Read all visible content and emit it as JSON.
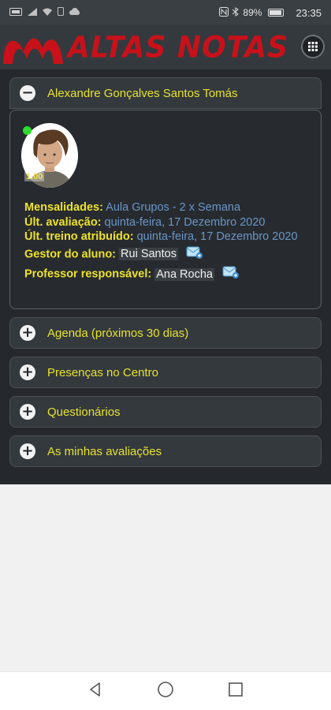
{
  "status_bar": {
    "left_icons": [
      "sim-icon",
      "signal-icon",
      "wifi-icon",
      "notification-icon",
      "cloud-icon"
    ],
    "right_icons": [
      "nfc-icon",
      "bluetooth-icon"
    ],
    "battery": "89%",
    "battery_level": 0.89,
    "time": "23:35"
  },
  "header": {
    "logo_text": "ALTAS NOTAS",
    "brand_color": "#c8111a",
    "menu_icon": "grid-icon"
  },
  "accordion": {
    "student": {
      "title": "Alexandre Gonçalves Santos Tomás",
      "toggle": "−",
      "level_badge": "1.00",
      "fields": {
        "mensalidades_label": "Mensalidades:",
        "mensalidades_value": "Aula Grupos - 2 x Semana",
        "ult_avaliacao_label": "Últ. avaliação:",
        "ult_avaliacao_value": "quinta-feira, 17 Dezembro 2020",
        "ult_treino_label": "Últ. treino atribuído:",
        "ult_treino_value": "quinta-feira, 17 Dezembro 2020",
        "gestor_label": "Gestor do aluno:",
        "gestor_value": "Rui Santos",
        "professor_label": "Professor responsável:",
        "professor_value": "Ana Rocha"
      }
    },
    "sections": [
      {
        "title": "Agenda (próximos 30 dias)",
        "toggle": "+"
      },
      {
        "title": "Presenças no Centro",
        "toggle": "+"
      },
      {
        "title": "Questionários",
        "toggle": "+"
      },
      {
        "title": "As minhas avaliações",
        "toggle": "+"
      }
    ]
  },
  "colors": {
    "label": "#ede22a",
    "value": "#6a95c8",
    "section_title": "#e6e22e",
    "background": "#25292d"
  },
  "nav": {
    "icons": [
      "back-icon",
      "home-icon",
      "recents-icon"
    ]
  }
}
